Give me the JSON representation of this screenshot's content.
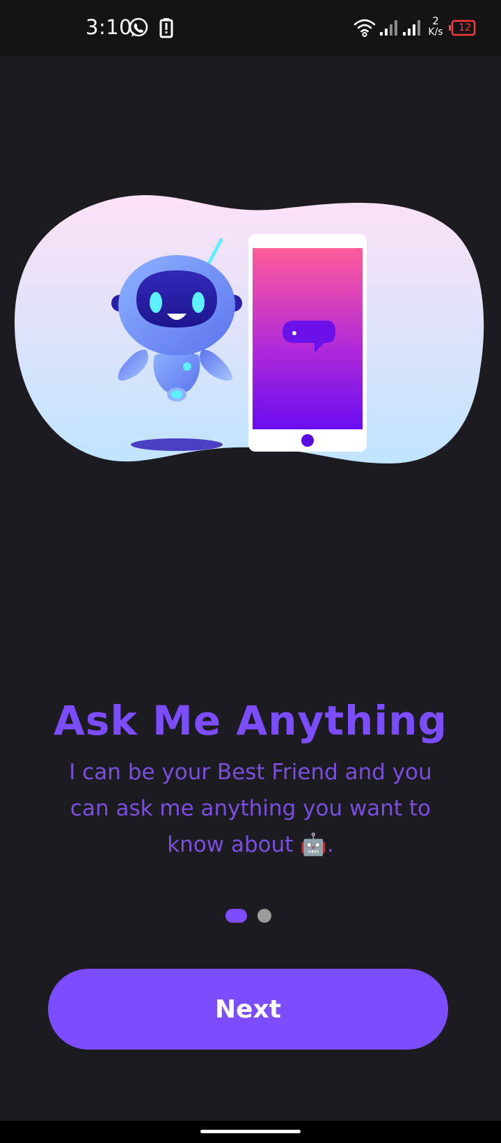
{
  "status_bar": {
    "time": "3:10",
    "net_speed_value": "2",
    "net_speed_unit": "K/s",
    "battery_level": "12",
    "icons": [
      "whatsapp-icon",
      "battery-saver-icon",
      "wifi-icon",
      "signal-icon",
      "signal-icon",
      "battery-icon"
    ]
  },
  "onboarding": {
    "title": "Ask Me Anything",
    "description": "I can be your Best Friend and you can ask me anything you want to know about 🤖.",
    "page_count": 2,
    "active_page": 1,
    "next_label": "Next"
  },
  "illustration": {
    "icon": "robot-chat-illustration",
    "colors": {
      "blob_top": "#fde2f6",
      "blob_bottom": "#c0e4ff",
      "phone_screen_top": "#ff5c9a",
      "phone_screen_bottom": "#6a0cf0",
      "robot_body": "#6b8ff5",
      "robot_face": "#2a1fa8",
      "robot_eye": "#5ff0ff"
    }
  },
  "colors": {
    "background": "#1c1b20",
    "accent": "#7c4dff",
    "title": "#7b4dff",
    "description": "#7a4fe0",
    "dot_inactive": "#9b9b9b"
  }
}
